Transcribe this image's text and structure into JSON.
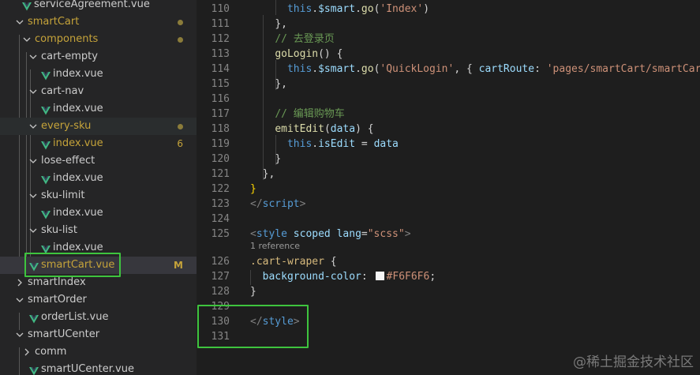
{
  "explorer": {
    "items": [
      {
        "label": "serviceAgreement.vue",
        "type": "file",
        "indent": 1,
        "modified": false
      },
      {
        "label": "smartCart",
        "type": "folder",
        "open": true,
        "indent": 1,
        "modified": true
      },
      {
        "label": "components",
        "type": "folder",
        "open": true,
        "indent": 2,
        "modified": true
      },
      {
        "label": "cart-empty",
        "type": "folder",
        "open": true,
        "indent": 3
      },
      {
        "label": "index.vue",
        "type": "file",
        "indent": 4
      },
      {
        "label": "cart-nav",
        "type": "folder",
        "open": true,
        "indent": 3
      },
      {
        "label": "index.vue",
        "type": "file",
        "indent": 4
      },
      {
        "label": "every-sku",
        "type": "folder",
        "open": true,
        "indent": 3,
        "modified": true
      },
      {
        "label": "index.vue",
        "type": "file",
        "indent": 4,
        "modified": true,
        "badge": "6"
      },
      {
        "label": "lose-effect",
        "type": "folder",
        "open": true,
        "indent": 3
      },
      {
        "label": "index.vue",
        "type": "file",
        "indent": 4
      },
      {
        "label": "sku-limit",
        "type": "folder",
        "open": true,
        "indent": 3
      },
      {
        "label": "index.vue",
        "type": "file",
        "indent": 4
      },
      {
        "label": "sku-list",
        "type": "folder",
        "open": true,
        "indent": 3
      },
      {
        "label": "index.vue",
        "type": "file",
        "indent": 4
      },
      {
        "label": "smartCart.vue",
        "type": "file",
        "indent": 2,
        "modified": true,
        "badge": "M",
        "active": true
      },
      {
        "label": "smartIndex",
        "type": "folder",
        "open": false,
        "indent": 1
      },
      {
        "label": "smartOrder",
        "type": "folder",
        "open": true,
        "indent": 1
      },
      {
        "label": "orderList.vue",
        "type": "file",
        "indent": 2
      },
      {
        "label": "smartUCenter",
        "type": "folder",
        "open": true,
        "indent": 1
      },
      {
        "label": "comm",
        "type": "folder",
        "open": false,
        "indent": 2
      },
      {
        "label": "smartUCenter.vue",
        "type": "file",
        "indent": 2
      }
    ]
  },
  "editor": {
    "codelens": "1 reference",
    "lines": [
      {
        "n": "110",
        "tokens": [
          [
            "      ",
            "plain"
          ],
          [
            "this",
            "kw"
          ],
          [
            ".",
            "plain"
          ],
          [
            "$smart",
            "var"
          ],
          [
            ".",
            "plain"
          ],
          [
            "go",
            "fn"
          ],
          [
            "(",
            "plain"
          ],
          [
            "'Index'",
            "str"
          ],
          [
            ")",
            "plain"
          ]
        ]
      },
      {
        "n": "111",
        "tokens": [
          [
            "    ",
            "plain"
          ],
          [
            "},",
            "plain"
          ]
        ]
      },
      {
        "n": "112",
        "tokens": [
          [
            "    ",
            "plain"
          ],
          [
            "// 去登录页",
            "cmt"
          ]
        ]
      },
      {
        "n": "113",
        "tokens": [
          [
            "    ",
            "plain"
          ],
          [
            "goLogin",
            "fn"
          ],
          [
            "() {",
            "plain"
          ]
        ]
      },
      {
        "n": "114",
        "tokens": [
          [
            "      ",
            "plain"
          ],
          [
            "this",
            "kw"
          ],
          [
            ".",
            "plain"
          ],
          [
            "$smart",
            "var"
          ],
          [
            ".",
            "plain"
          ],
          [
            "go",
            "fn"
          ],
          [
            "(",
            "plain"
          ],
          [
            "'QuickLogin'",
            "str"
          ],
          [
            ", { ",
            "plain"
          ],
          [
            "cartRoute",
            "var"
          ],
          [
            ": ",
            "plain"
          ],
          [
            "'pages/smartCart/smartCart'",
            "str"
          ]
        ]
      },
      {
        "n": "115",
        "tokens": [
          [
            "    ",
            "plain"
          ],
          [
            "},",
            "plain"
          ]
        ]
      },
      {
        "n": "116",
        "tokens": []
      },
      {
        "n": "117",
        "tokens": [
          [
            "    ",
            "plain"
          ],
          [
            "// 编辑购物车",
            "cmt"
          ]
        ]
      },
      {
        "n": "118",
        "tokens": [
          [
            "    ",
            "plain"
          ],
          [
            "emitEdit",
            "fn"
          ],
          [
            "(",
            "plain"
          ],
          [
            "data",
            "var"
          ],
          [
            ") {",
            "plain"
          ]
        ]
      },
      {
        "n": "119",
        "tokens": [
          [
            "      ",
            "plain"
          ],
          [
            "this",
            "kw"
          ],
          [
            ".",
            "plain"
          ],
          [
            "isEdit",
            "var"
          ],
          [
            " = ",
            "plain"
          ],
          [
            "data",
            "var"
          ]
        ]
      },
      {
        "n": "120",
        "tokens": [
          [
            "    ",
            "plain"
          ],
          [
            "}",
            "plain"
          ]
        ]
      },
      {
        "n": "121",
        "tokens": [
          [
            "  ",
            "plain"
          ],
          [
            "},",
            "plain"
          ]
        ]
      },
      {
        "n": "122",
        "tokens": [
          [
            "}",
            "brk"
          ]
        ]
      },
      {
        "n": "123",
        "tokens": [
          [
            "</",
            "punct"
          ],
          [
            "script",
            "tag"
          ],
          [
            ">",
            "punct"
          ]
        ]
      },
      {
        "n": "124",
        "tokens": []
      },
      {
        "n": "125",
        "tokens": [
          [
            "<",
            "punct"
          ],
          [
            "style",
            "tag"
          ],
          [
            " ",
            "plain"
          ],
          [
            "scoped",
            "attr"
          ],
          [
            " ",
            "plain"
          ],
          [
            "lang",
            "attr"
          ],
          [
            "=",
            "plain"
          ],
          [
            "\"scss\"",
            "str"
          ],
          [
            ">",
            "punct"
          ]
        ]
      },
      {
        "n": "126",
        "tokens": [
          [
            ".cart-wraper",
            "sel"
          ],
          [
            " {",
            "plain"
          ]
        ]
      },
      {
        "n": "127",
        "tokens": [
          [
            "  ",
            "plain"
          ],
          [
            "background-color",
            "attr"
          ],
          [
            ": ",
            "plain"
          ],
          [
            "SWATCH",
            "swatch"
          ],
          [
            "#F6F6F6",
            "num"
          ],
          [
            ";",
            "plain"
          ]
        ]
      },
      {
        "n": "128",
        "tokens": [
          [
            "}",
            "plain"
          ]
        ]
      },
      {
        "n": "129",
        "tokens": []
      },
      {
        "n": "130",
        "tokens": [
          [
            "</",
            "punct"
          ],
          [
            "style",
            "tag"
          ],
          [
            ">",
            "punct"
          ]
        ]
      },
      {
        "n": "131",
        "tokens": []
      }
    ]
  },
  "watermark": "@稀土掘金技术社区",
  "colors": {
    "accent_box": "#3ec43e",
    "modified": "#c5a33a",
    "vue_icon": "#41b883"
  }
}
